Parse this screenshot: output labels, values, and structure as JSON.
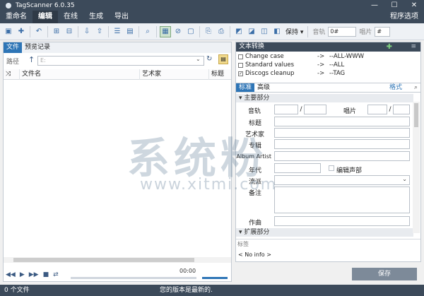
{
  "window": {
    "title": "TagScanner 6.0.35",
    "minimize": "—",
    "maximize": "☐",
    "close": "✕"
  },
  "menu": {
    "items": [
      "重命名",
      "编辑",
      "在线",
      "生成",
      "导出"
    ],
    "active_index": 1,
    "right": "程序选项"
  },
  "toolbar": {
    "keep_label": "保持 ▾",
    "track_label": "音轨",
    "track_value": "0#",
    "disc_label": "唱片",
    "disc_value": "#"
  },
  "left": {
    "tabs": [
      "文件",
      "预览记录"
    ],
    "path_label": "路径",
    "path_value": "E:",
    "columns": [
      "文件名",
      "艺术家",
      "标题"
    ]
  },
  "player": {
    "time": "00:00"
  },
  "right": {
    "header": "文本转换",
    "converters": [
      {
        "name": "Change case",
        "target": "--ALL-WWW",
        "checked": false
      },
      {
        "name": "Standard values",
        "target": "--ALL",
        "checked": false
      },
      {
        "name": "Discogs cleanup",
        "target": "--TAG",
        "checked": true
      }
    ],
    "tabs": [
      "标准",
      "高级"
    ],
    "format_tab": "格式",
    "section_main": "主要部分",
    "labels": {
      "track": "音轨",
      "disc": "唱片",
      "title": "标题",
      "artist": "艺术家",
      "album": "专辑",
      "album_artist": "Album Artist",
      "year": "年代",
      "compilation": "编辑声部",
      "genre": "流派",
      "comment": "备注",
      "composer": "作曲"
    },
    "slash": "/",
    "section_ext": "扩展部分",
    "tags_label": "标签",
    "no_info": "< No info >"
  },
  "save_label": "保存",
  "status": {
    "files": "0 个文件",
    "version": "您的版本是最新的."
  },
  "watermark": {
    "cn": "系统粉",
    "url": "www.xitmi.com"
  }
}
